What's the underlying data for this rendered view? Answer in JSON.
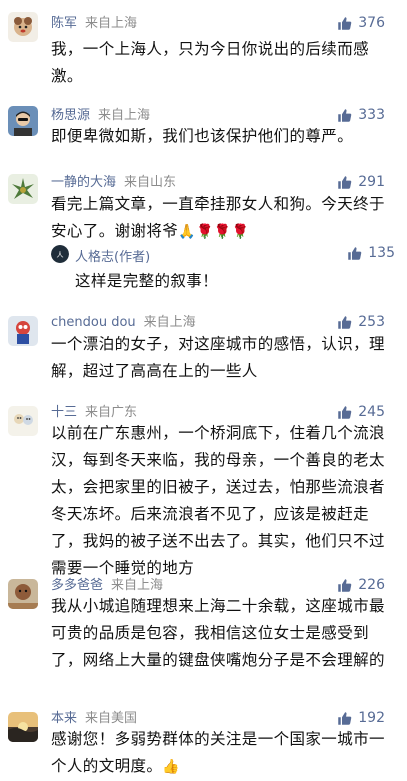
{
  "comments": [
    {
      "name": "陈军",
      "location": "来自上海",
      "likes": "376",
      "text": "我，一个上海人，只为今日你说出的后续而感激。"
    },
    {
      "name": "杨思源",
      "location": "来自上海",
      "likes": "333",
      "text": "即便卑微如斯，我们也该保护他们的尊严。"
    },
    {
      "name": "一静的大海",
      "location": "来自山东",
      "likes": "291",
      "text": "看完上篇文章，一直牵挂那女人和狗。今天终于安心了。谢谢将爷",
      "emojis": "🙏🌹🌹🌹",
      "reply": {
        "name": "人格志(作者)",
        "likes": "135",
        "text": "这样是完整的叙事！"
      }
    },
    {
      "name": "chendou dou",
      "location": "来自上海",
      "likes": "253",
      "text": "一个漂泊的女子，对这座城市的感悟，认识，理解，超过了高高在上的一些人"
    },
    {
      "name": "十三",
      "location": "来自广东",
      "likes": "245",
      "text": "以前在广东惠州，一个桥洞底下，住着几个流浪汉，每到冬天来临，我的母亲，一个善良的老太太，会把家里的旧被子，送过去，怕那些流浪者冬天冻坏。后来流浪者不见了，应该是被赶走了，我妈的被子送不出去了。其实，他们只不过需要一个睡觉的地方"
    },
    {
      "name": "多多爸爸",
      "location": "来自上海",
      "likes": "226",
      "text": "我从小城追随理想来上海二十余载，这座城市最可贵的品质是包容，我相信这位女士是感受到了，网络上大量的键盘侠嘴炮分子是不会理解的"
    },
    {
      "name": "本来",
      "location": "来自美国",
      "likes": "192",
      "text": "感谢您！多弱势群体的关注是一个国家一城市一个人的文明度。",
      "emojis": "👍"
    }
  ],
  "colors": {
    "name": "#576b95",
    "location": "#8c8c8c",
    "text": "#111111",
    "like": "#576b95"
  }
}
